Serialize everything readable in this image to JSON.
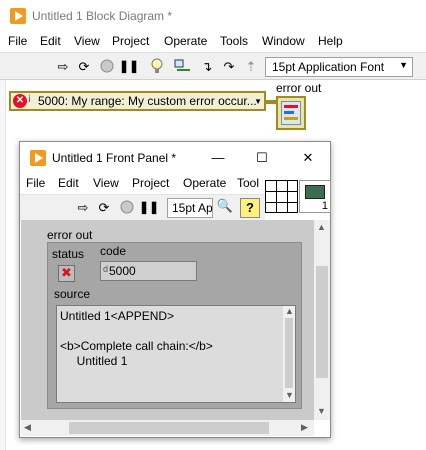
{
  "block_diagram": {
    "title": "Untitled 1 Block Diagram *",
    "menu": [
      "File",
      "Edit",
      "View",
      "Project",
      "Operate",
      "Tools",
      "Window",
      "Help"
    ],
    "toolbar": {
      "icons": [
        "run-arrow-icon",
        "run-continuously-icon",
        "abort-icon",
        "pause-icon",
        "highlight-execution-icon",
        "retain-wire-values-icon",
        "step-into-icon",
        "step-over-icon",
        "step-out-icon"
      ],
      "font_label": "15pt Application Font"
    },
    "error_constant": {
      "text": "5000: My range: My custom error occur..."
    },
    "terminal_label": "error out"
  },
  "front_panel": {
    "title": "Untitled 1 Front Panel *",
    "window_controls": {
      "minimize": "—",
      "maximize": "☐",
      "close": "✕"
    },
    "menu": [
      "File",
      "Edit",
      "View",
      "Project",
      "Operate",
      "Tool"
    ],
    "toolbar": {
      "font_label": "15pt Ap",
      "help_label": "?"
    },
    "icon_number": "1",
    "error_cluster": {
      "label": "error out",
      "status_label": "status",
      "code_label": "code",
      "code_radix": "d",
      "code_value": "5000",
      "source_label": "source",
      "source_text": "Untitled 1<APPEND>\n\n<b>Complete call chain:</b>\n     Untitled 1"
    }
  },
  "colors": {
    "app_icon": "#f39a1e",
    "error_wire": "#a08c1c",
    "panel_bg": "#cacaca",
    "cluster_bg": "#a6a6a6",
    "status_x": "#d7171f"
  }
}
